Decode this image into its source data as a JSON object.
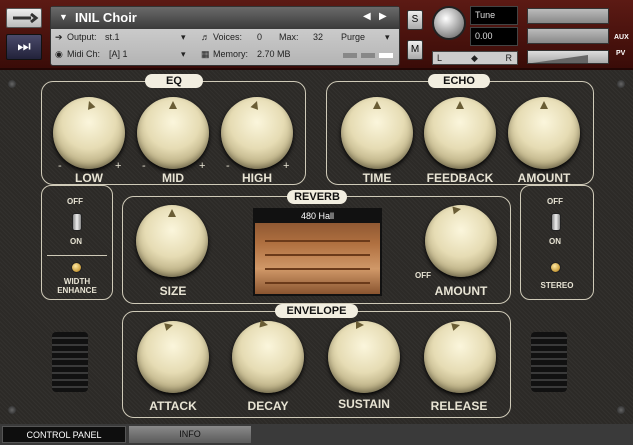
{
  "header": {
    "instrument_name": "INIL Choir",
    "output_label": "Output:",
    "output_value": "st.1",
    "midi_label": "Midi Ch:",
    "midi_value": "[A] 1",
    "voices_label": "Voices:",
    "voices_value": "0",
    "max_label": "Max:",
    "max_value": "32",
    "memory_label": "Memory:",
    "memory_value": "2.70 MB",
    "purge_label": "Purge",
    "solo_label": "S",
    "mute_label": "M",
    "tune_label": "Tune",
    "tune_value": "0.00",
    "pan_left": "L",
    "pan_right": "R",
    "aux_label": "AUX",
    "pv_label": "PV"
  },
  "eq": {
    "title": "EQ",
    "knobs": [
      {
        "label": "LOW"
      },
      {
        "label": "MID"
      },
      {
        "label": "HIGH"
      }
    ],
    "minus": "-",
    "plus": "+"
  },
  "echo": {
    "title": "ECHO",
    "knobs": [
      {
        "label": "TIME"
      },
      {
        "label": "FEEDBACK"
      },
      {
        "label": "AMOUNT"
      }
    ]
  },
  "reverb": {
    "title": "REVERB",
    "preset": "480 Hall",
    "size_label": "SIZE",
    "amount_label": "AMOUNT",
    "off_label": "OFF"
  },
  "envelope": {
    "title": "ENVELOPE",
    "knobs": [
      {
        "label": "ATTACK"
      },
      {
        "label": "DECAY"
      },
      {
        "label": "SUSTAIN"
      },
      {
        "label": "RELEASE"
      }
    ]
  },
  "width": {
    "off": "OFF",
    "on": "ON",
    "label": "WIDTH\nENHANCE"
  },
  "stereo": {
    "off": "OFF",
    "on": "ON",
    "label": "STEREO"
  },
  "tabs": [
    {
      "label": "CONTROL PANEL"
    },
    {
      "label": "INFO"
    }
  ]
}
